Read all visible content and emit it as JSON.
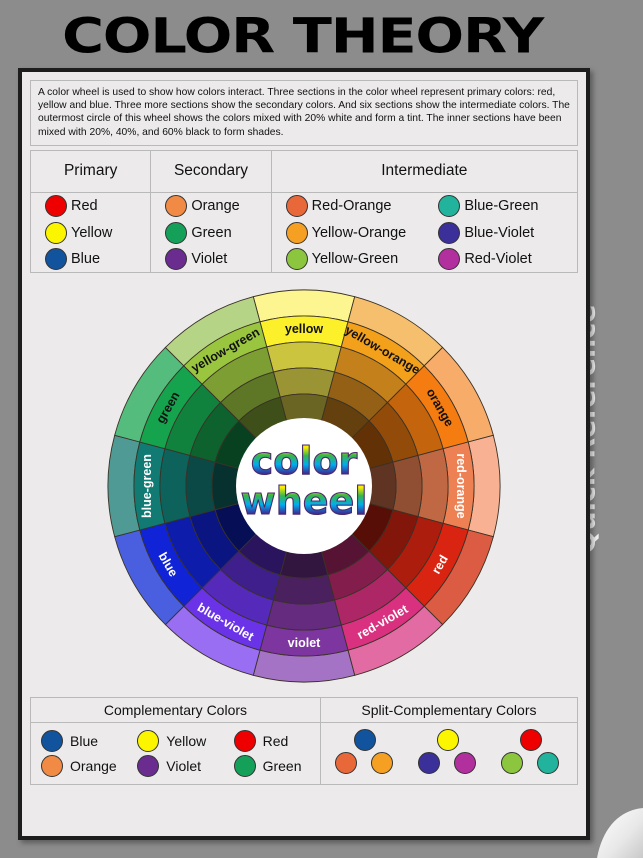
{
  "page": {
    "title": "COLOR THEORY",
    "rail_label": "Quick Reference",
    "help_icon": "question-mark-icon",
    "background_color": "#8c8c8c",
    "card_background": "#eceaea"
  },
  "description": "A color wheel is used to show how colors interact.  Three sections in the color wheel represent primary colors: red, yellow and blue. Three more sections show the secondary colors.  And six sections show the intermediate colors.  The outermost circle of this wheel shows the colors mixed with 20% white and form a tint.  The inner sections have been mixed with 20%, 40%, and 60% black to form shades.",
  "legend": {
    "headers": [
      "Primary",
      "Secondary",
      "Intermediate"
    ],
    "primary": [
      {
        "label": "Red",
        "color": "#ef0000"
      },
      {
        "label": "Yellow",
        "color": "#fcf500"
      },
      {
        "label": "Blue",
        "color": "#11539c"
      }
    ],
    "secondary": [
      {
        "label": "Orange",
        "color": "#f08a45"
      },
      {
        "label": "Green",
        "color": "#15a05a"
      },
      {
        "label": "Violet",
        "color": "#6a2c8f"
      }
    ],
    "intermediate_left": [
      {
        "label": "Red-Orange",
        "color": "#e8683a"
      },
      {
        "label": "Yellow-Orange",
        "color": "#f5a023"
      },
      {
        "label": "Yellow-Green",
        "color": "#8cc63f"
      }
    ],
    "intermediate_right": [
      {
        "label": "Blue-Green",
        "color": "#21b39b"
      },
      {
        "label": "Blue-Violet",
        "color": "#3b2f99"
      },
      {
        "label": "Red-Violet",
        "color": "#b22f9e"
      }
    ]
  },
  "wheel": {
    "center_label_line1": "color",
    "center_label_line2": "wheel",
    "ring_count": 5,
    "sector_count": 12,
    "sectors": [
      {
        "label": "yellow",
        "label_color": "#111111",
        "ring_colors": [
          "#fdf590",
          "#fcf02b",
          "#cbc43f",
          "#9a9434",
          "#6a6523"
        ]
      },
      {
        "label": "yellow-orange",
        "label_color": "#111111",
        "ring_colors": [
          "#f6bf6d",
          "#f3a01b",
          "#c4801b",
          "#946015",
          "#63400e"
        ]
      },
      {
        "label": "orange",
        "label_color": "#111111",
        "ring_colors": [
          "#f7ac6a",
          "#f47c10",
          "#c4640d",
          "#934b0a",
          "#623206"
        ]
      },
      {
        "label": "red-orange",
        "label_color": "#ffffff",
        "ring_colors": [
          "#f8b293",
          "#ee8153",
          "#c06843",
          "#904e32",
          "#603422"
        ]
      },
      {
        "label": "red",
        "label_color": "#ffffff",
        "ring_colors": [
          "#dc5b43",
          "#d92412",
          "#ad1d0e",
          "#82160b",
          "#570e07"
        ]
      },
      {
        "label": "red-violet",
        "label_color": "#ffffff",
        "ring_colors": [
          "#e16ba2",
          "#d9317f",
          "#ad2766",
          "#821d4c",
          "#571333"
        ]
      },
      {
        "label": "violet",
        "label_color": "#ffffff",
        "ring_colors": [
          "#a473c5",
          "#7d359f",
          "#642b7f",
          "#4b205f",
          "#32163f"
        ]
      },
      {
        "label": "blue-violet",
        "label_color": "#ffffff",
        "ring_colors": [
          "#9a6ef2",
          "#6a33e8",
          "#5529ba",
          "#3f1f8b",
          "#2a145d"
        ]
      },
      {
        "label": "blue",
        "label_color": "#ffffff",
        "ring_colors": [
          "#4a5fe0",
          "#1023d6",
          "#0d1cab",
          "#0a1581",
          "#060e56"
        ]
      },
      {
        "label": "blue-green",
        "label_color": "#ffffff",
        "ring_colors": [
          "#4f9a94",
          "#117a73",
          "#0e625c",
          "#0a4945",
          "#07312e"
        ]
      },
      {
        "label": "green",
        "label_color": "#111111",
        "ring_colors": [
          "#54bd7d",
          "#15a34d",
          "#11823e",
          "#0d622e",
          "#08411f"
        ]
      },
      {
        "label": "yellow-green",
        "label_color": "#111111",
        "ring_colors": [
          "#b6d486",
          "#9ac63f",
          "#7c9e32",
          "#5d7726",
          "#3e4f19"
        ]
      }
    ]
  },
  "bottom": {
    "complementary_title": "Complementary Colors",
    "split_title": "Split-Complementary Colors",
    "complementary_pairs": [
      {
        "top_label": "Blue",
        "top_color": "#11539c",
        "bottom_label": "Orange",
        "bottom_color": "#f08a45"
      },
      {
        "top_label": "Yellow",
        "top_color": "#fcf500",
        "bottom_label": "Violet",
        "bottom_color": "#6a2c8f"
      },
      {
        "top_label": "Red",
        "top_color": "#ef0000",
        "bottom_label": "Green",
        "bottom_color": "#15a05a"
      }
    ],
    "split_groups": [
      {
        "top_color": "#11539c",
        "left_color": "#e8683a",
        "right_color": "#f5a023"
      },
      {
        "top_color": "#fcf500",
        "left_color": "#3b2f99",
        "right_color": "#b22f9e"
      },
      {
        "top_color": "#ef0000",
        "left_color": "#8cc63f",
        "right_color": "#21b39b"
      }
    ]
  }
}
